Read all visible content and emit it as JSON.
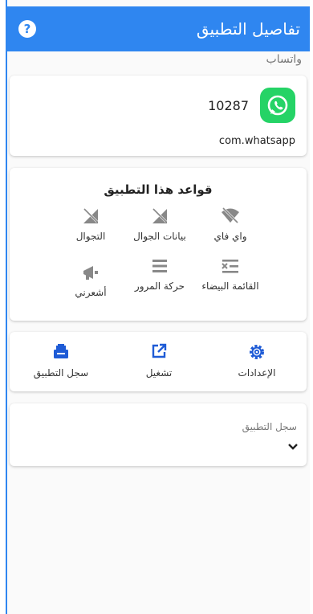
{
  "appbar": {
    "title": "تفاصيل التطبيق",
    "help_icon": "help-icon",
    "color": "#2f86f0"
  },
  "app": {
    "name": "واتساب",
    "uid": "10287",
    "package": "com.whatsapp",
    "icon": "whatsapp-icon",
    "icon_color": "#25d366"
  },
  "rules": {
    "title": "قواعد هذا التطبيق",
    "items": [
      {
        "label": "واي فاي",
        "icon": "wifi-off-icon"
      },
      {
        "label": "بيانات الجوال",
        "icon": "mobile-data-off-icon"
      },
      {
        "label": "التجوال",
        "icon": "roaming-off-icon"
      },
      {
        "label": "القائمة البيضاء",
        "icon": "whitelist-icon"
      },
      {
        "label": "حركة المرور",
        "icon": "traffic-icon"
      },
      {
        "label": "أشعرني",
        "icon": "notify-icon"
      }
    ]
  },
  "actions": [
    {
      "label": "الإعدادات",
      "icon": "gear-icon"
    },
    {
      "label": "تشغيل",
      "icon": "launch-icon"
    },
    {
      "label": "سجل التطبيق",
      "icon": "log-icon"
    }
  ],
  "log": {
    "label": "سجل التطبيق",
    "icon": "chevron-down-icon"
  }
}
